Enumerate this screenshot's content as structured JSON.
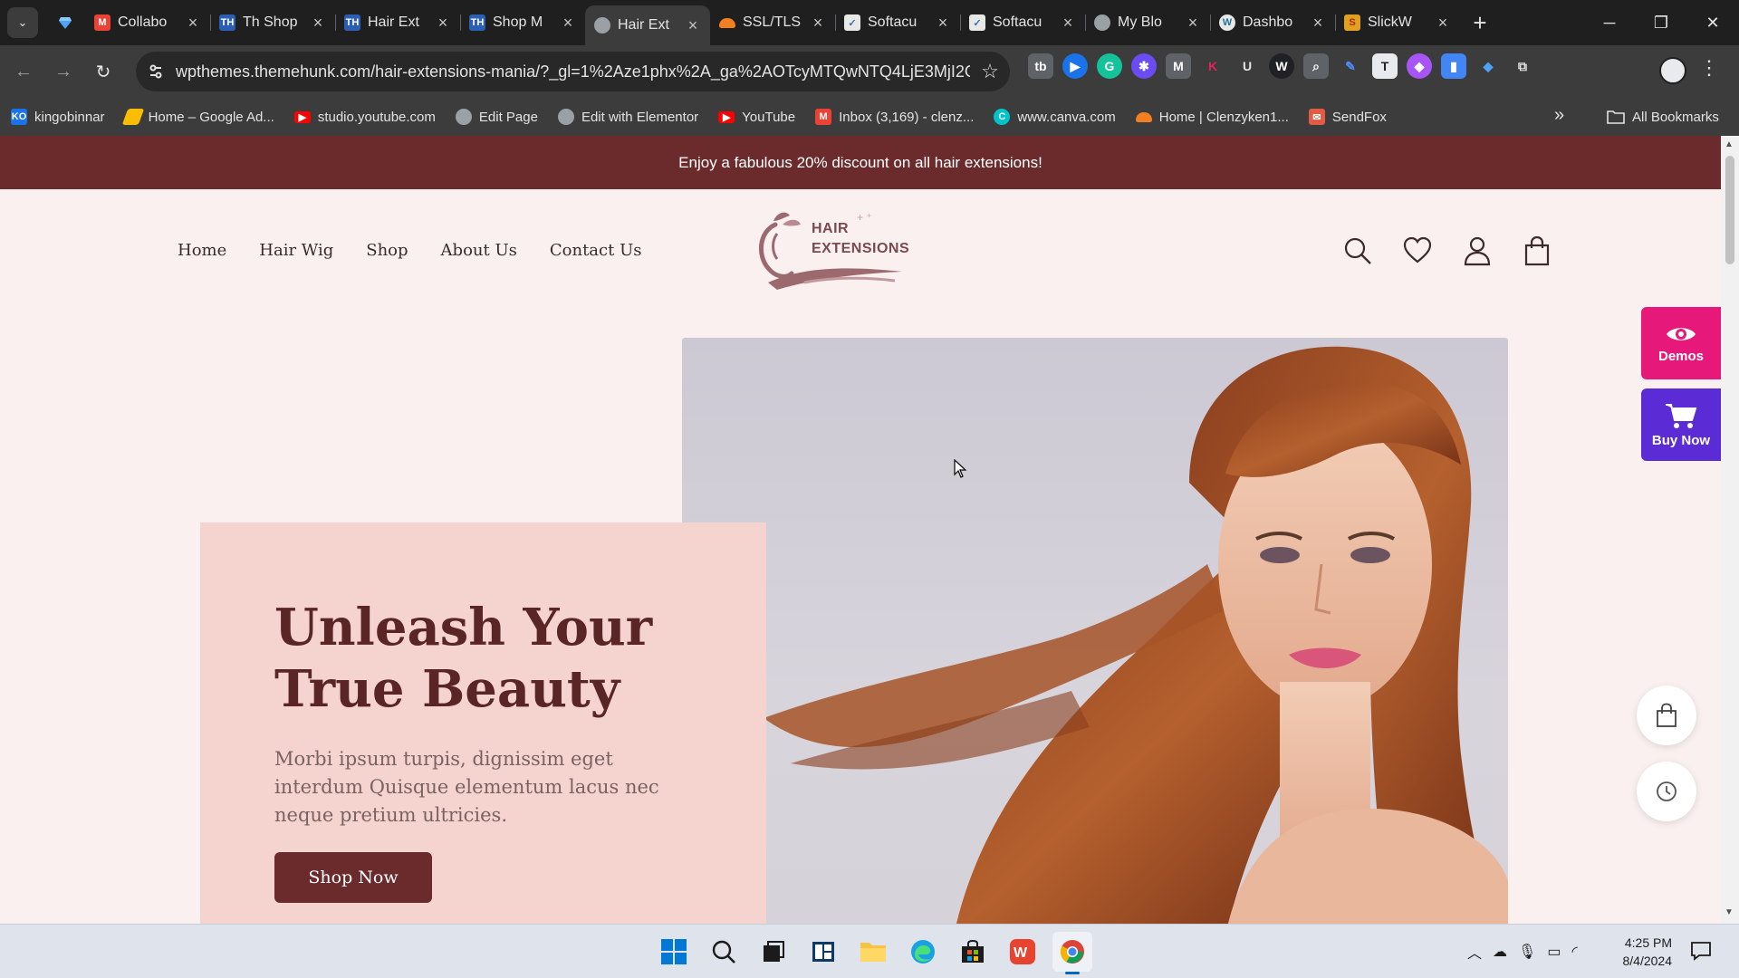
{
  "browser": {
    "tabs": [
      {
        "title": "Collabo",
        "favicon": "gmail-icon",
        "color": "#ea4335"
      },
      {
        "title": "Th Shop",
        "favicon": "themehunk-icon",
        "color": "#2b5fb4"
      },
      {
        "title": "Hair Ext",
        "favicon": "themehunk-icon",
        "color": "#2b5fb4"
      },
      {
        "title": "Shop M",
        "favicon": "themehunk-icon",
        "color": "#2b5fb4"
      },
      {
        "title": "Hair Ext",
        "favicon": "globe-icon",
        "color": "#9aa0a6",
        "active": true
      },
      {
        "title": "SSL/TLS",
        "favicon": "cloudflare-icon",
        "color": "#f38020"
      },
      {
        "title": "Softacu",
        "favicon": "softaculous-icon",
        "color": "#e8e8e8"
      },
      {
        "title": "Softacu",
        "favicon": "softaculous-icon",
        "color": "#e8e8e8"
      },
      {
        "title": "My Blo",
        "favicon": "globe-icon",
        "color": "#9aa0a6"
      },
      {
        "title": "Dashbo",
        "favicon": "wordpress-icon",
        "color": "#e8e8e8"
      },
      {
        "title": "SlickW",
        "favicon": "slickwrite-icon",
        "color": "#e0a020"
      }
    ],
    "url": "wpthemes.themehunk.com/hair-extensions-mania/?_gl=1%2Aze1phx%2A_ga%2AOTcyMTQwNTQ4LjE3MjI2O...",
    "bookmarks": [
      {
        "label": "kingobinnar",
        "icon": "ko-icon",
        "color": "#1a73e8"
      },
      {
        "label": "Home – Google Ad...",
        "icon": "google-ads-icon",
        "color": "#fbbc04"
      },
      {
        "label": "studio.youtube.com",
        "icon": "youtube-icon",
        "color": "#ff0000"
      },
      {
        "label": "Edit Page",
        "icon": "globe-icon",
        "color": "#9aa0a6"
      },
      {
        "label": "Edit with Elementor",
        "icon": "globe-icon",
        "color": "#9aa0a6"
      },
      {
        "label": "YouTube",
        "icon": "youtube-icon",
        "color": "#ff0000"
      },
      {
        "label": "Inbox (3,169) - clenz...",
        "icon": "gmail-icon",
        "color": "#ea4335"
      },
      {
        "label": "www.canva.com",
        "icon": "canva-icon",
        "color": "#00c4cc"
      },
      {
        "label": "Home | Clenzyken1...",
        "icon": "cloudflare-icon",
        "color": "#f38020"
      },
      {
        "label": "SendFox",
        "icon": "sendfox-icon",
        "color": "#e25b45"
      }
    ],
    "all_bookmarks": "All Bookmarks"
  },
  "site": {
    "announcement": "Enjoy a fabulous 20% discount on all hair extensions!",
    "nav": [
      "Home",
      "Hair Wig",
      "Shop",
      "About Us",
      "Contact Us"
    ],
    "logo_line1": "HAIR",
    "logo_line2": "EXTENSIONS",
    "hero": {
      "title": "Unleash Your True Beauty",
      "description": "Morbi ipsum turpis, dignissim eget interdum Quisque elementum lacus nec neque pretium ultricies.",
      "button": "Shop Now"
    },
    "side_buttons": {
      "demos": "Demos",
      "buy": "Buy Now"
    },
    "colors": {
      "brand": "#6b2a2c",
      "card": "#f5d4cf",
      "demos": "#e6197a",
      "buy": "#5b2bd6"
    }
  },
  "taskbar": {
    "time": "4:25 PM",
    "date": "8/4/2024"
  }
}
